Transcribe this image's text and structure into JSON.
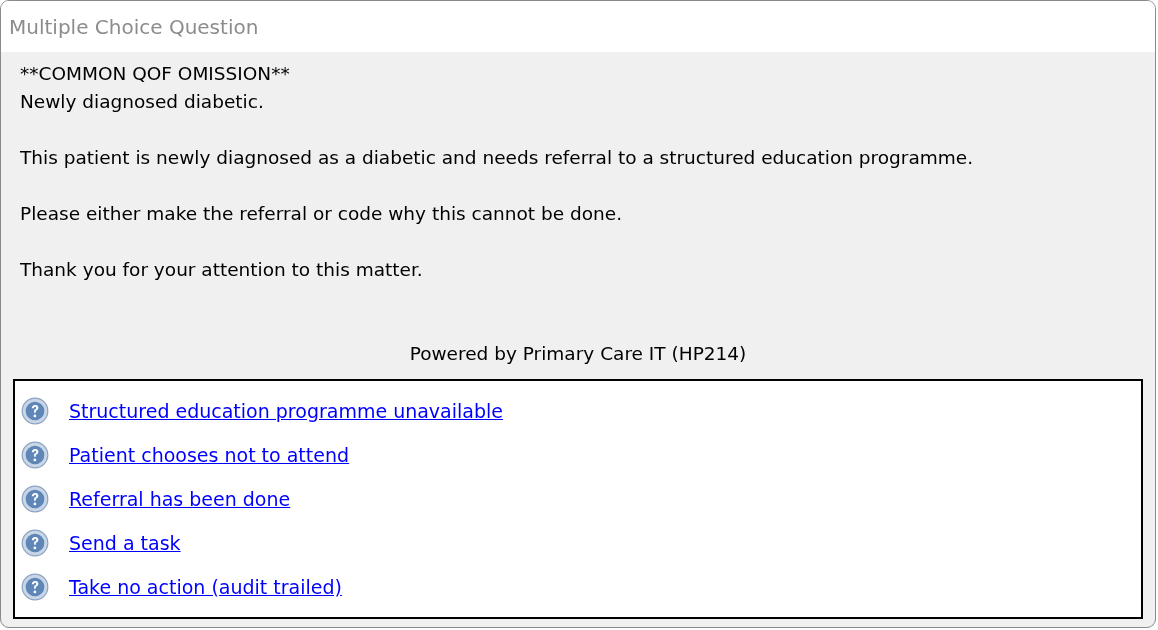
{
  "window": {
    "title": "Multiple Choice Question"
  },
  "message": {
    "heading": "**COMMON QOF OMISSION**",
    "subheading": "Newly diagnosed diabetic.",
    "paragraphs": [
      "This patient is newly diagnosed as a diabetic and needs referral to a structured education programme.",
      "Please either make the referral or code why this cannot be done.",
      "Thank you for your attention to this matter."
    ]
  },
  "footer": "Powered by Primary Care IT (HP214)",
  "options": [
    {
      "label": "Structured education programme unavailable"
    },
    {
      "label": "Patient chooses not to attend"
    },
    {
      "label": "Referral has been done"
    },
    {
      "label": "Send a task"
    },
    {
      "label": "Take no action (audit trailed)"
    }
  ]
}
